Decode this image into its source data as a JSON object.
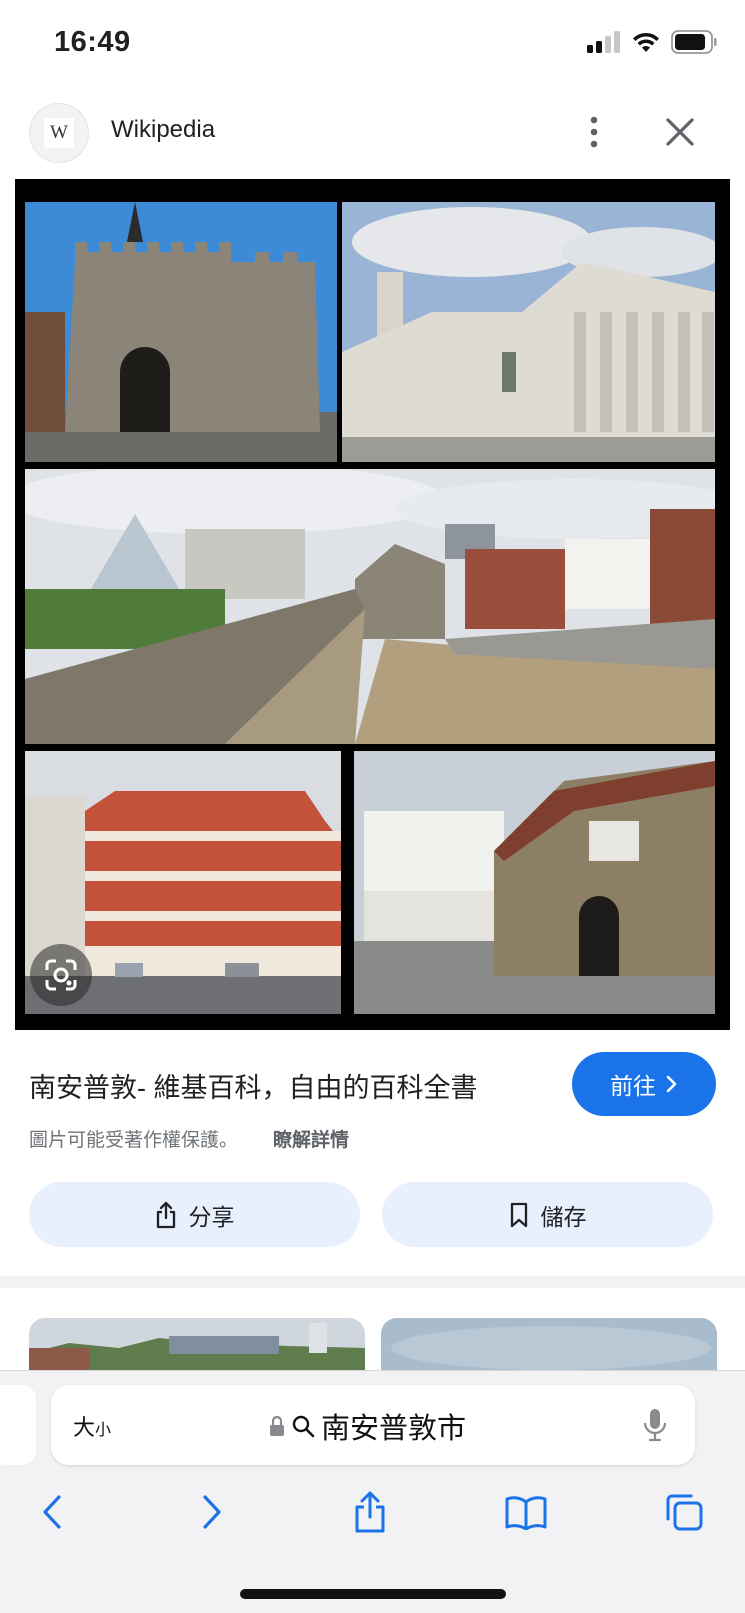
{
  "status": {
    "time": "16:49",
    "icons": [
      "signal-icon",
      "wifi-icon",
      "battery-icon"
    ]
  },
  "header": {
    "logo_letter": "W",
    "site_name": "Wikipedia"
  },
  "result": {
    "title": "南安普敦- 維基百科，自由的百科全書",
    "visit_label": "前往",
    "copyright_notice": "圖片可能受著作權保護。",
    "learn_more": "瞭解詳情",
    "share_label": "分享",
    "save_label": "儲存"
  },
  "browser": {
    "text_size_label": "大",
    "text_size_small": "小",
    "address": "南安普敦市"
  },
  "colors": {
    "accent": "#1a73e8",
    "pill_bg": "#e8f0fe",
    "toolbar_icon": "#1a73e8"
  }
}
